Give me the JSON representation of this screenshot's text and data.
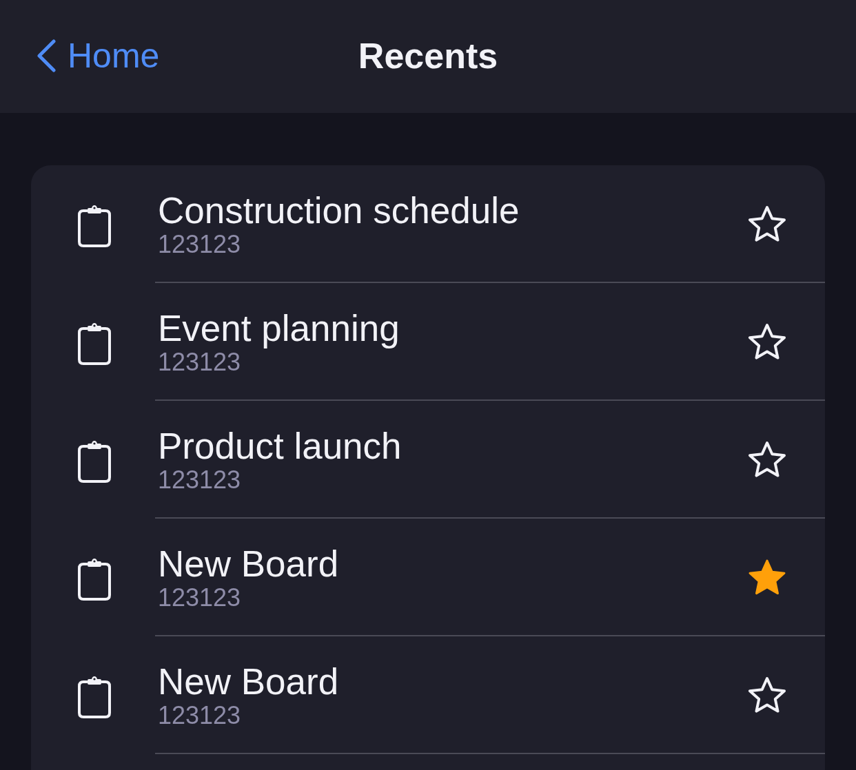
{
  "nav": {
    "back_label": "Home",
    "title": "Recents"
  },
  "boards": [
    {
      "title": "Construction schedule",
      "subtitle": "123123",
      "starred": false
    },
    {
      "title": "Event planning",
      "subtitle": "123123",
      "starred": false
    },
    {
      "title": "Product launch",
      "subtitle": "123123",
      "starred": false
    },
    {
      "title": "New Board",
      "subtitle": "123123",
      "starred": true
    },
    {
      "title": "New Board",
      "subtitle": "123123",
      "starred": false
    }
  ]
}
